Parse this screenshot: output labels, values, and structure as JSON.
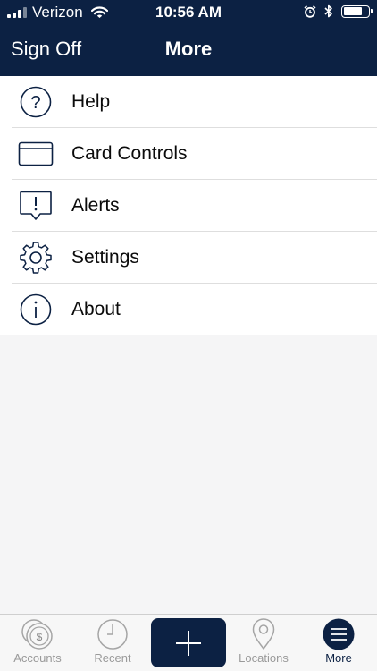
{
  "status_bar": {
    "carrier": "Verizon",
    "time": "10:56 AM",
    "battery_level": 0.75
  },
  "nav": {
    "left_button": "Sign Off",
    "title": "More"
  },
  "menu": {
    "items": [
      {
        "label": "Help",
        "icon": "question-circle-icon"
      },
      {
        "label": "Card Controls",
        "icon": "credit-card-icon"
      },
      {
        "label": "Alerts",
        "icon": "alert-bubble-icon"
      },
      {
        "label": "Settings",
        "icon": "gear-icon"
      },
      {
        "label": "About",
        "icon": "info-circle-icon"
      }
    ]
  },
  "tab_bar": {
    "items": [
      {
        "label": "Accounts",
        "icon": "coins-icon",
        "active": false
      },
      {
        "label": "Recent",
        "icon": "clock-icon",
        "active": false
      },
      {
        "label": "",
        "icon": "plus-icon",
        "active": false
      },
      {
        "label": "Locations",
        "icon": "location-pin-icon",
        "active": false
      },
      {
        "label": "More",
        "icon": "menu-icon",
        "active": true
      }
    ]
  },
  "colors": {
    "brand_navy": "#0c2143",
    "tab_inactive": "#9a9a9a",
    "background": "#f5f5f6"
  }
}
